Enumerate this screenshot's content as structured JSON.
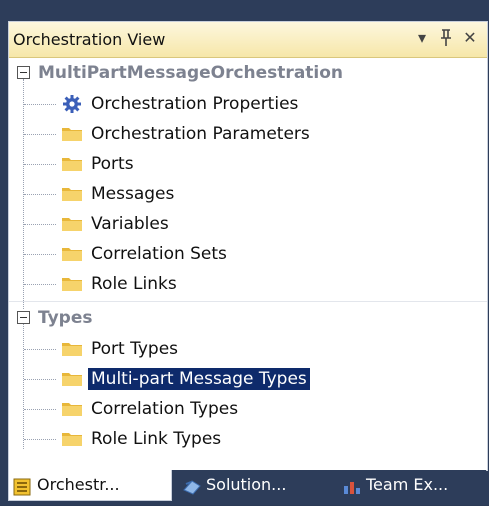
{
  "panel": {
    "title": "Orchestration View",
    "dropdown_glyph": "▾",
    "pin_glyph": "ꟸ",
    "close_glyph": "✕"
  },
  "tree": {
    "orchestration": {
      "label": "MultiPartMessageOrchestration",
      "items": [
        {
          "label": "Orchestration Properties",
          "icon": "gear-icon"
        },
        {
          "label": "Orchestration Parameters",
          "icon": "folder-icon"
        },
        {
          "label": "Ports",
          "icon": "folder-icon"
        },
        {
          "label": "Messages",
          "icon": "folder-icon"
        },
        {
          "label": "Variables",
          "icon": "folder-icon"
        },
        {
          "label": "Correlation Sets",
          "icon": "folder-icon"
        },
        {
          "label": "Role Links",
          "icon": "folder-icon"
        }
      ]
    },
    "types": {
      "label": "Types",
      "items": [
        {
          "label": "Port Types",
          "icon": "folder-icon"
        },
        {
          "label": "Multi-part Message Types",
          "icon": "folder-icon",
          "selected": true
        },
        {
          "label": "Correlation Types",
          "icon": "folder-icon"
        },
        {
          "label": "Role Link Types",
          "icon": "folder-icon"
        }
      ]
    }
  },
  "tabs": [
    {
      "label": "Orchestr...",
      "icon": "orchestration-view-icon",
      "active": true
    },
    {
      "label": "Solution...",
      "icon": "solution-explorer-icon",
      "active": false
    },
    {
      "label": "Team Ex...",
      "icon": "team-explorer-icon",
      "active": false
    }
  ],
  "colors": {
    "selection": "#0e2a6b",
    "titlebar": "#f6e7a9",
    "folder": "#f2c94c"
  }
}
